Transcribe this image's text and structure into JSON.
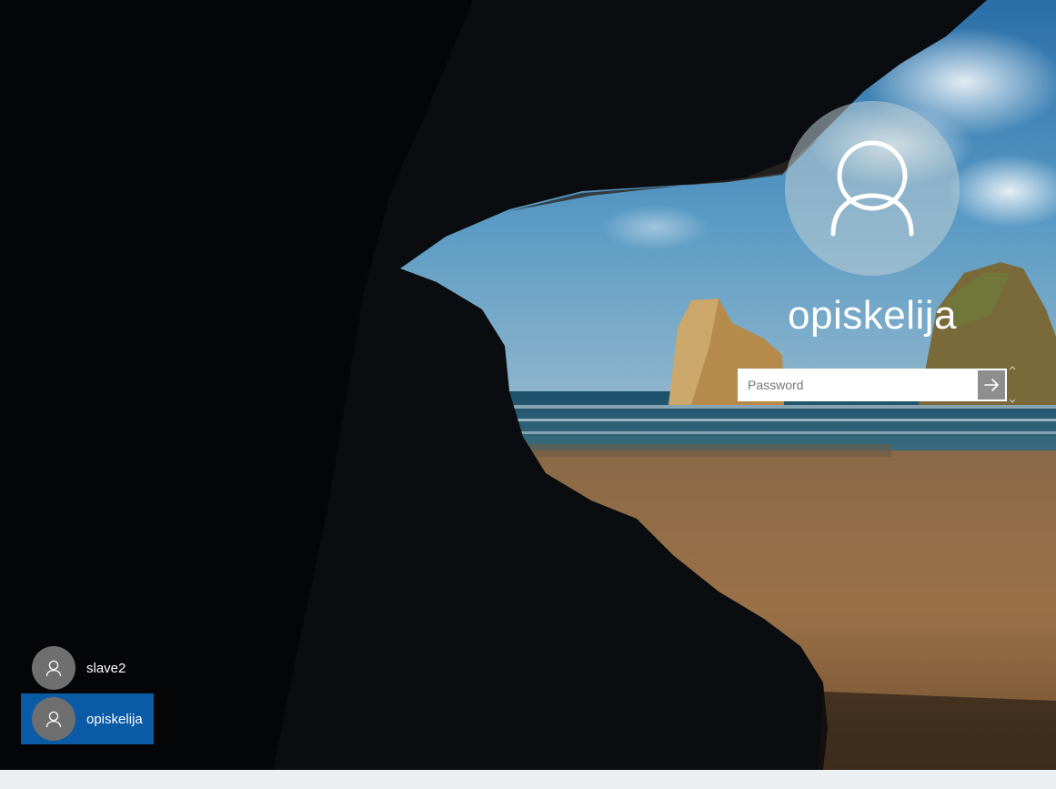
{
  "login": {
    "username": "opiskelija",
    "password_placeholder": "Password"
  },
  "user_list": [
    {
      "name": "slave2",
      "selected": false
    },
    {
      "name": "opiskelija",
      "selected": true
    }
  ],
  "icons": {
    "avatar": "user-silhouette-icon",
    "submit": "arrow-right-icon",
    "scroll_up": "chevron-up-icon",
    "scroll_down": "chevron-down-icon"
  },
  "colors": {
    "selected_tile": "#0a5aa6",
    "avatar_bg": "#6f6f6f",
    "submit_bg": "#8e8e8e"
  }
}
